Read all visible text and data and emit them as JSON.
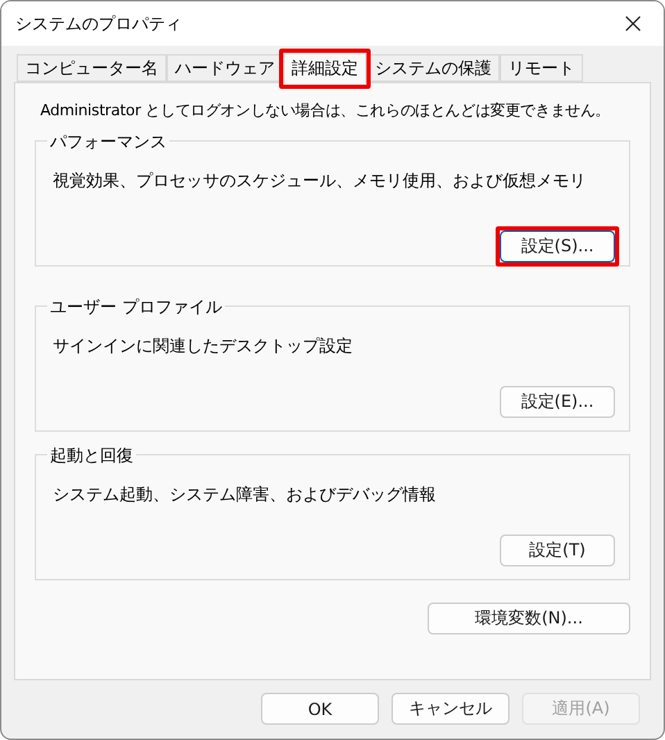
{
  "window": {
    "title": "システムのプロパティ"
  },
  "tabs": [
    {
      "label": "コンピューター名",
      "selected": false,
      "highlighted": false
    },
    {
      "label": "ハードウェア",
      "selected": false,
      "highlighted": false
    },
    {
      "label": "詳細設定",
      "selected": true,
      "highlighted": true
    },
    {
      "label": "システムの保護",
      "selected": false,
      "highlighted": false
    },
    {
      "label": "リモート",
      "selected": false,
      "highlighted": false
    }
  ],
  "notice": "Administrator としてログオンしない場合は、これらのほとんどは変更できません。",
  "groups": [
    {
      "title": "パフォーマンス",
      "description": "視覚効果、プロセッサのスケジュール、メモリ使用、および仮想メモリ",
      "button": {
        "label": "設定(S)...",
        "focused": true,
        "highlighted": true
      }
    },
    {
      "title": "ユーザー プロファイル",
      "description": "サインインに関連したデスクトップ設定",
      "button": {
        "label": "設定(E)...",
        "focused": false,
        "highlighted": false
      }
    },
    {
      "title": "起動と回復",
      "description": "システム起動、システム障害、およびデバッグ情報",
      "button": {
        "label": "設定(T)",
        "focused": false,
        "highlighted": false
      }
    }
  ],
  "environment_button": {
    "label": "環境変数(N)..."
  },
  "buttons": [
    {
      "label": "OK",
      "disabled": false
    },
    {
      "label": "キャンセル",
      "disabled": false
    },
    {
      "label": "適用(A)",
      "disabled": true
    }
  ]
}
